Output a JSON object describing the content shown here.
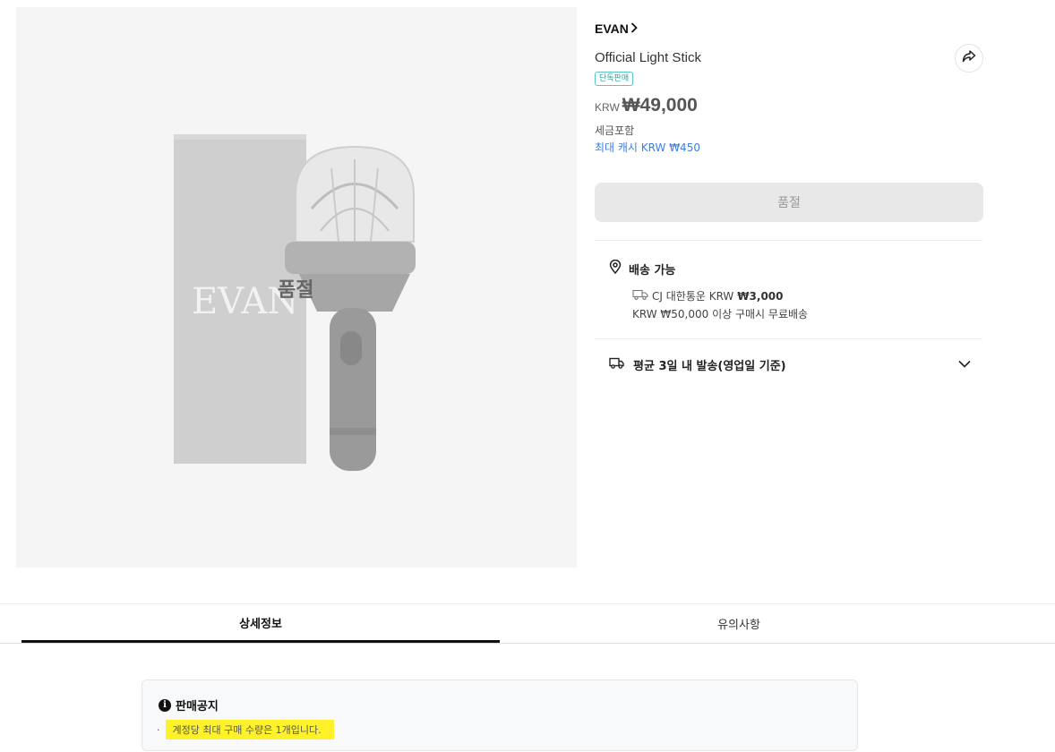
{
  "product": {
    "image_overlay_text": "품절",
    "image_box_text": "EVAN",
    "brand": "EVAN",
    "name": "Official Light Stick",
    "badge": "단독판매",
    "price_currency": "KRW",
    "price": "₩49,000",
    "tax_note": "세금포함",
    "cash_note": "최대 캐시 KRW ₩450",
    "soldout_button": "품절"
  },
  "shipping": {
    "title": "배송 가능",
    "carrier": "CJ 대한통운 KRW",
    "fee": "₩3,000",
    "free_note": "KRW ₩50,000 이상 구매시 무료배송"
  },
  "dispatch": {
    "label": "평균 3일 내 발송(영업일 기준)"
  },
  "tabs": [
    {
      "label": "상세정보",
      "active": true
    },
    {
      "label": "유의사항",
      "active": false
    }
  ],
  "notice": {
    "title": "판매공지",
    "items": [
      "계정당 최대 구매 수량은 1개입니다."
    ]
  },
  "icons": {
    "brand_chevron": "chevron-right-icon",
    "share": "share-icon",
    "location": "location-pin-icon",
    "truck": "truck-icon",
    "expand": "chevron-down-icon",
    "info": "info-icon"
  },
  "colors": {
    "accent_blue": "#3d7ee0",
    "badge_teal": "#2aa5a5",
    "highlight": "#fff22a",
    "disabled_button": "#e8e8e8"
  }
}
